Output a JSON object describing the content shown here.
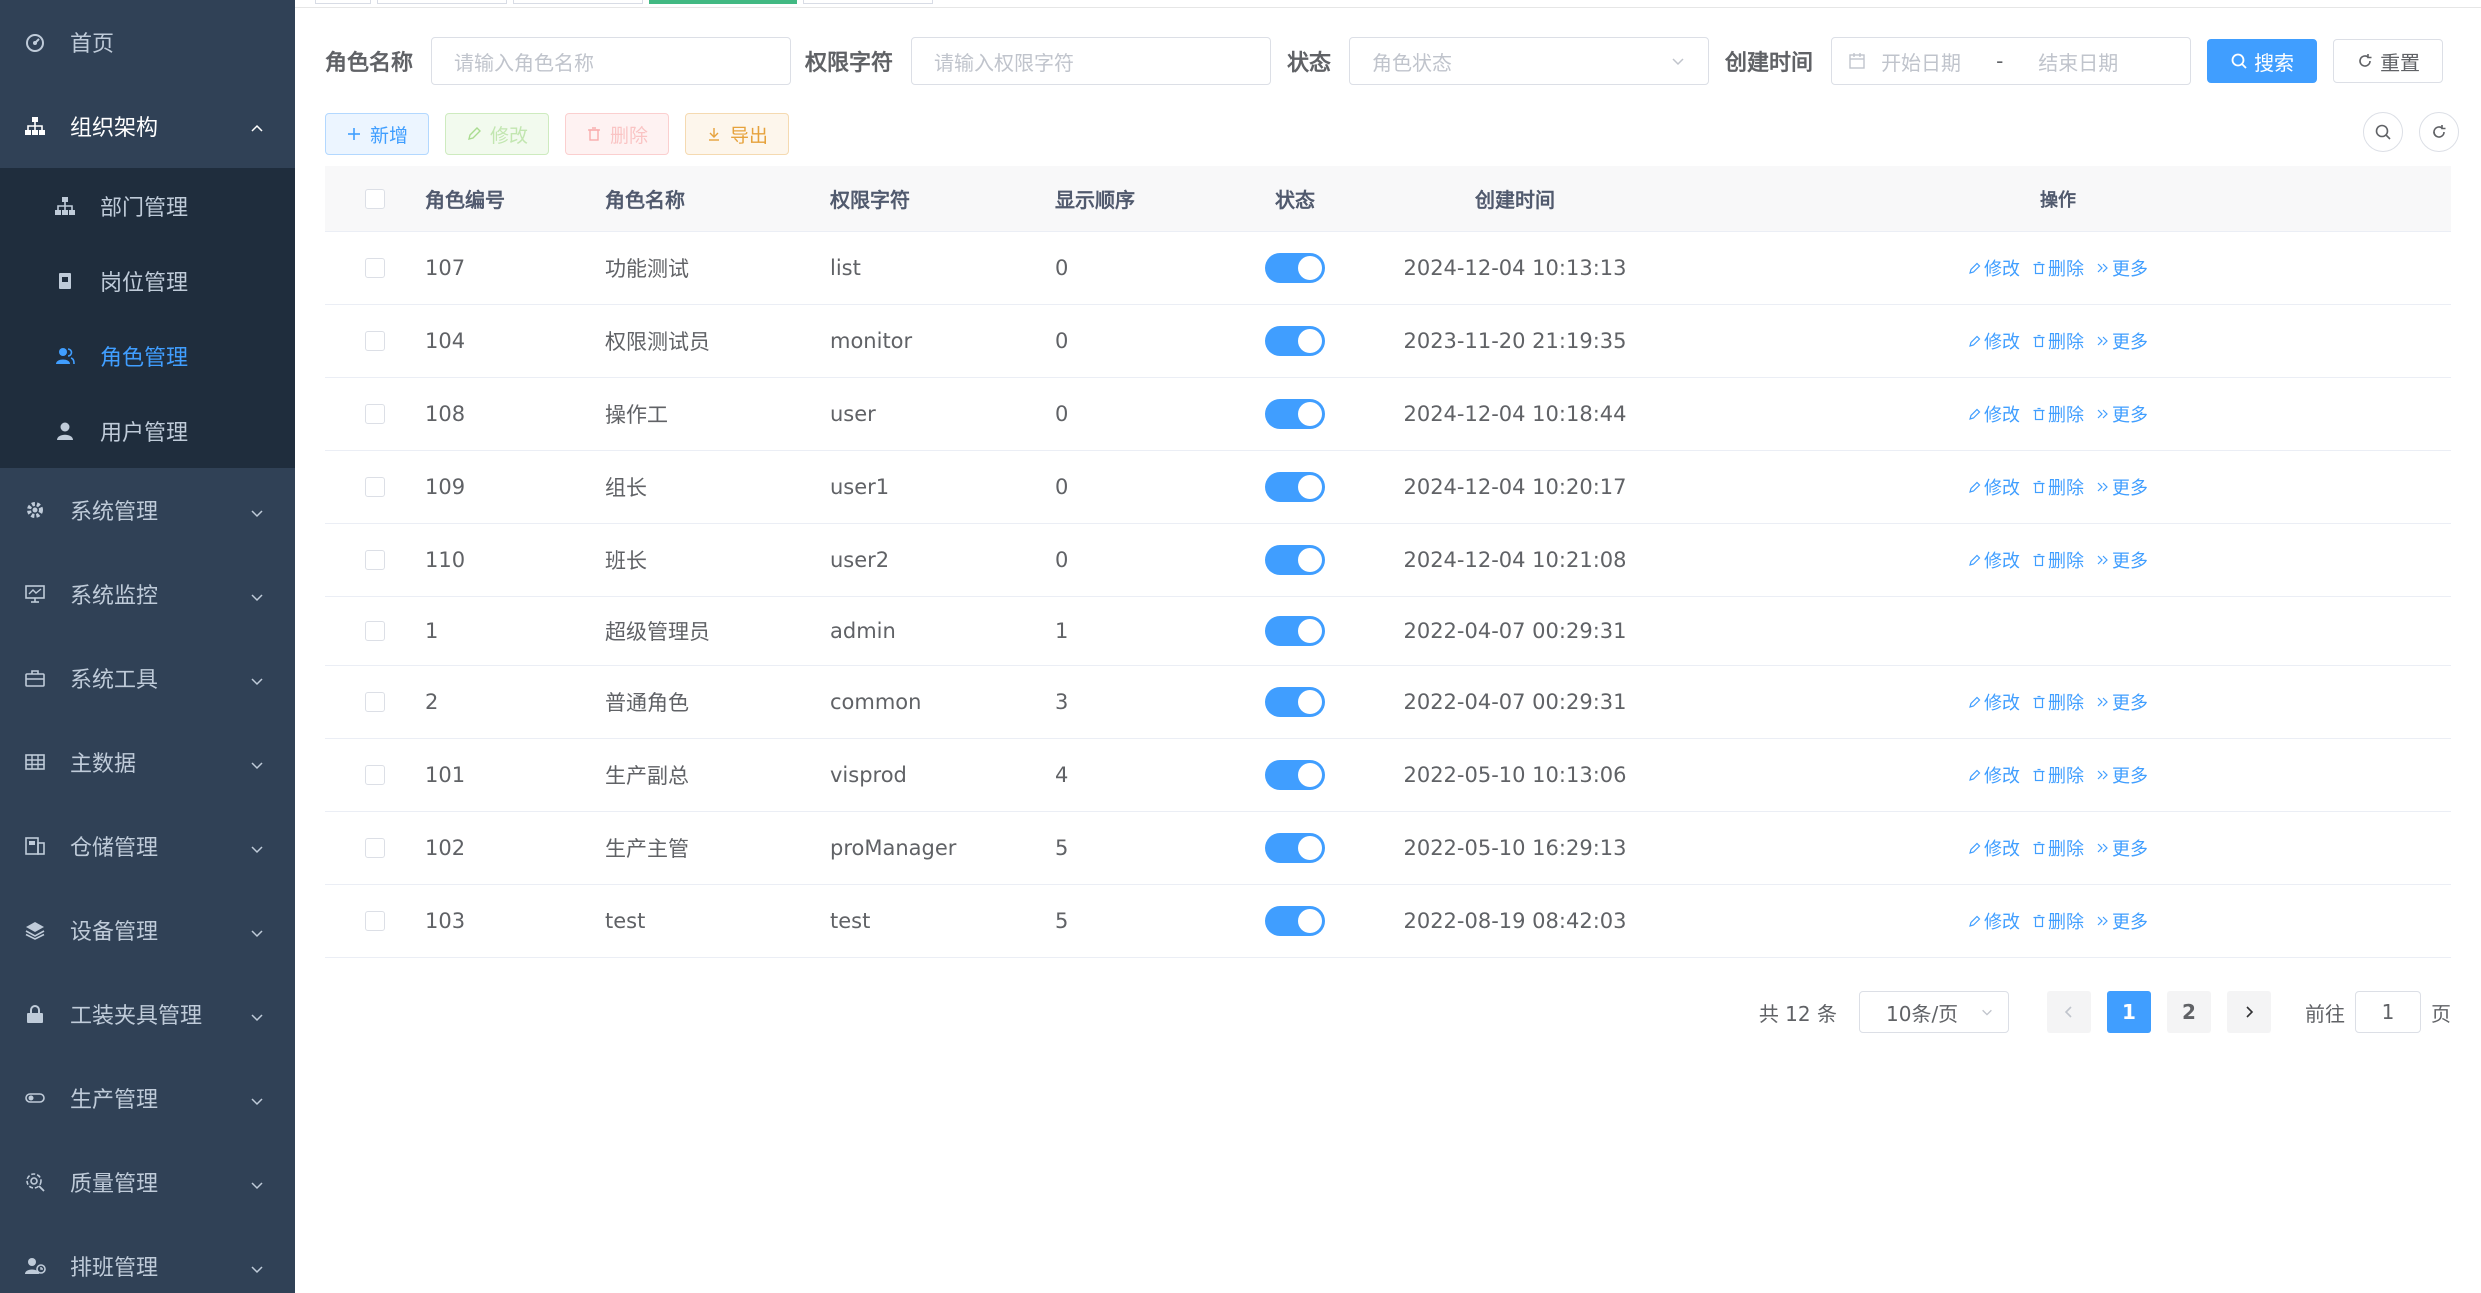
{
  "sidebar": {
    "items": [
      {
        "label": "首页",
        "icon": "dashboard-icon"
      },
      {
        "label": "组织架构",
        "icon": "tree-icon",
        "opened": true,
        "children": [
          {
            "label": "部门管理",
            "icon": "tree-icon"
          },
          {
            "label": "岗位管理",
            "icon": "post-icon"
          },
          {
            "label": "角色管理",
            "icon": "peoples-icon",
            "active": true
          },
          {
            "label": "用户管理",
            "icon": "user-icon"
          }
        ]
      },
      {
        "label": "系统管理",
        "icon": "gear-icon"
      },
      {
        "label": "系统监控",
        "icon": "monitor-icon"
      },
      {
        "label": "系统工具",
        "icon": "toolbox-icon"
      },
      {
        "label": "主数据",
        "icon": "table-icon"
      },
      {
        "label": "仓储管理",
        "icon": "warehouse-icon"
      },
      {
        "label": "设备管理",
        "icon": "layers-icon"
      },
      {
        "label": "工装夹具管理",
        "icon": "lock-icon"
      },
      {
        "label": "生产管理",
        "icon": "toggle-icon"
      },
      {
        "label": "质量管理",
        "icon": "quality-icon"
      },
      {
        "label": "排班管理",
        "icon": "schedule-icon"
      }
    ]
  },
  "search": {
    "role_name_label": "角色名称",
    "role_name_placeholder": "请输入角色名称",
    "role_key_label": "权限字符",
    "role_key_placeholder": "请输入权限字符",
    "status_label": "状态",
    "status_placeholder": "角色状态",
    "create_time_label": "创建时间",
    "start_placeholder": "开始日期",
    "range_separator": "-",
    "end_placeholder": "结束日期",
    "search_button": "搜索",
    "reset_button": "重置"
  },
  "toolbar": {
    "add": "新增",
    "edit": "修改",
    "delete": "删除",
    "export": "导出"
  },
  "table": {
    "columns": {
      "id": "角色编号",
      "name": "角色名称",
      "key": "权限字符",
      "sort": "显示顺序",
      "status": "状态",
      "create_time": "创建时间",
      "ops": "操作"
    },
    "op_labels": {
      "edit": "修改",
      "delete": "删除",
      "more": "更多"
    },
    "rows": [
      {
        "id": "107",
        "name": "功能测试",
        "key": "list",
        "sort": "0",
        "status": true,
        "create_time": "2024-12-04 10:13:13",
        "ops": true
      },
      {
        "id": "104",
        "name": "权限测试员",
        "key": "monitor",
        "sort": "0",
        "status": true,
        "create_time": "2023-11-20 21:19:35",
        "ops": true
      },
      {
        "id": "108",
        "name": "操作工",
        "key": "user",
        "sort": "0",
        "status": true,
        "create_time": "2024-12-04 10:18:44",
        "ops": true
      },
      {
        "id": "109",
        "name": "组长",
        "key": "user1",
        "sort": "0",
        "status": true,
        "create_time": "2024-12-04 10:20:17",
        "ops": true
      },
      {
        "id": "110",
        "name": "班长",
        "key": "user2",
        "sort": "0",
        "status": true,
        "create_time": "2024-12-04 10:21:08",
        "ops": true
      },
      {
        "id": "1",
        "name": "超级管理员",
        "key": "admin",
        "sort": "1",
        "status": true,
        "create_time": "2022-04-07 00:29:31",
        "ops": false
      },
      {
        "id": "2",
        "name": "普通角色",
        "key": "common",
        "sort": "3",
        "status": true,
        "create_time": "2022-04-07 00:29:31",
        "ops": true
      },
      {
        "id": "101",
        "name": "生产副总",
        "key": "visprod",
        "sort": "4",
        "status": true,
        "create_time": "2022-05-10 10:13:06",
        "ops": true
      },
      {
        "id": "102",
        "name": "生产主管",
        "key": "proManager",
        "sort": "5",
        "status": true,
        "create_time": "2022-05-10 16:29:13",
        "ops": true
      },
      {
        "id": "103",
        "name": "test",
        "key": "test",
        "sort": "5",
        "status": true,
        "create_time": "2022-08-19 08:42:03",
        "ops": true
      }
    ]
  },
  "pagination": {
    "total": "共 12 条",
    "page_size": "10条/页",
    "pages": [
      "1",
      "2"
    ],
    "current": "1",
    "goto_label": "前往",
    "goto_value": "1",
    "page_suffix": "页"
  },
  "colors": {
    "sidebar_bg": "#304156",
    "submenu_bg": "#1f2d3d",
    "primary": "#409eff"
  }
}
